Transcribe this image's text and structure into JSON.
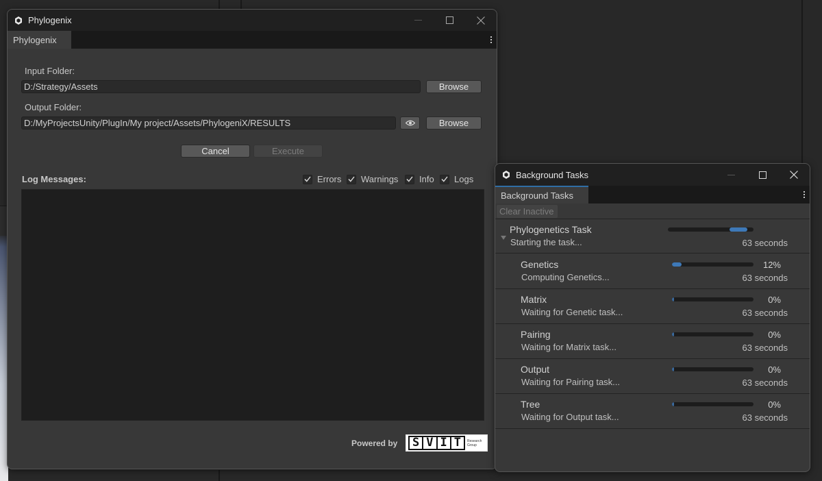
{
  "phylogenix": {
    "title": "Phylogenix",
    "tab": "Phylogenix",
    "input_label": "Input Folder:",
    "input_value": "D:/Strategy/Assets",
    "output_label": "Output Folder:",
    "output_value": "D:/MyProjectsUnity/PlugIn/My project/Assets/PhylogeniX/RESULTS",
    "browse": "Browse",
    "cancel": "Cancel",
    "execute": "Execute",
    "log_label": "Log Messages:",
    "filters": [
      {
        "label": "Errors",
        "checked": true
      },
      {
        "label": "Warnings",
        "checked": true
      },
      {
        "label": "Info",
        "checked": true
      },
      {
        "label": "Logs",
        "checked": true
      }
    ],
    "powered_by": "Powered by",
    "logo_letters": [
      "S",
      "V",
      "I",
      "T"
    ],
    "logo_sub": [
      "Research",
      "Group"
    ]
  },
  "tasks_window": {
    "title": "Background Tasks",
    "tab": "Background Tasks",
    "clear_inactive": "Clear Inactive",
    "parent": {
      "name": "Phylogenetics Task",
      "status": "Starting the task...",
      "time": "63 seconds",
      "progress_indeterminate": true
    },
    "tasks": [
      {
        "name": "Genetics",
        "status": "Computing Genetics...",
        "percent": "12%",
        "progress": 0.12,
        "time": "63 seconds"
      },
      {
        "name": "Matrix",
        "status": "Waiting for Genetic task...",
        "percent": "0%",
        "progress": 0,
        "time": "63 seconds"
      },
      {
        "name": "Pairing",
        "status": "Waiting for Matrix task...",
        "percent": "0%",
        "progress": 0,
        "time": "63 seconds"
      },
      {
        "name": "Output",
        "status": "Waiting for Pairing task...",
        "percent": "0%",
        "progress": 0,
        "time": "63 seconds"
      },
      {
        "name": "Tree",
        "status": "Waiting for Output task...",
        "percent": "0%",
        "progress": 0,
        "time": "63 seconds"
      }
    ]
  },
  "colors": {
    "accent": "#3e79b8",
    "tab_accent": "#2f6ea5"
  },
  "icons": [
    "unity-logo-icon",
    "minimize-icon",
    "maximize-icon",
    "close-icon",
    "kebab-menu-icon",
    "eye-icon",
    "checkmark-icon",
    "foldout-arrow-icon"
  ]
}
